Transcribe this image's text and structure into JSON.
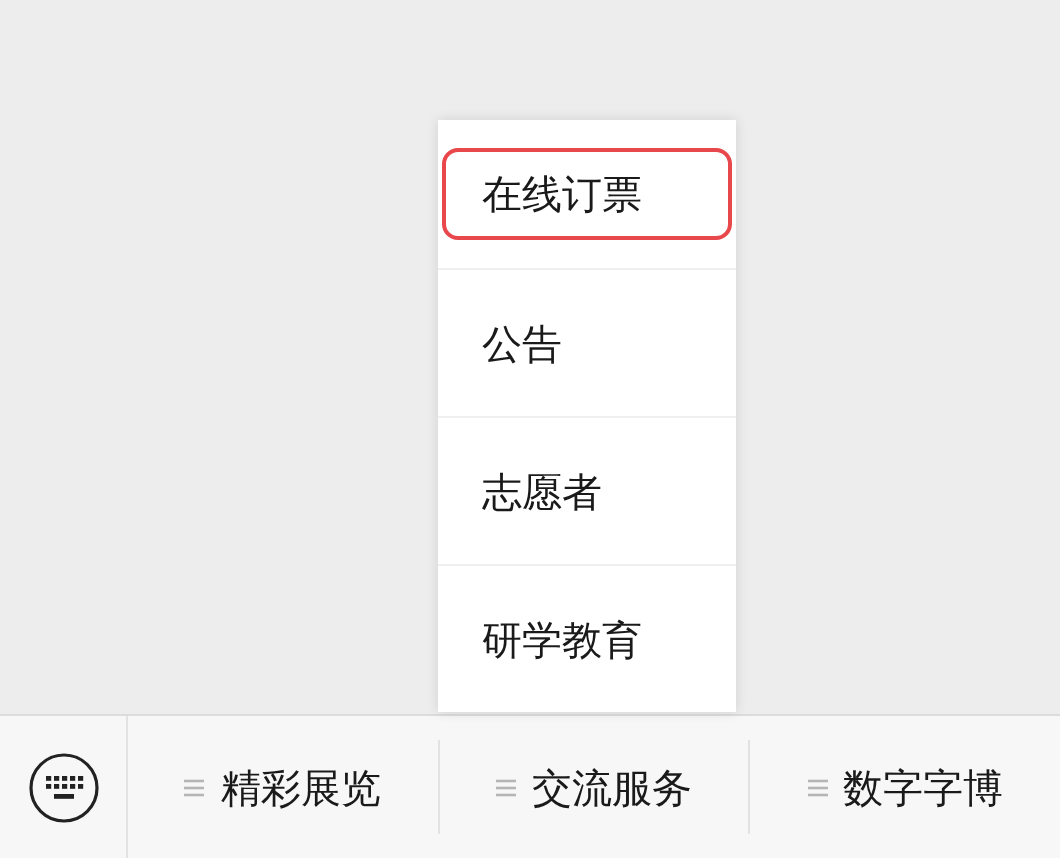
{
  "submenu": {
    "items": [
      {
        "label": "在线订票",
        "selected": true
      },
      {
        "label": "公告",
        "selected": false
      },
      {
        "label": "志愿者",
        "selected": false
      },
      {
        "label": "研学教育",
        "selected": false
      }
    ]
  },
  "menu_bar": {
    "items": [
      {
        "label": "精彩展览"
      },
      {
        "label": "交流服务"
      },
      {
        "label": "数字字博"
      }
    ]
  }
}
